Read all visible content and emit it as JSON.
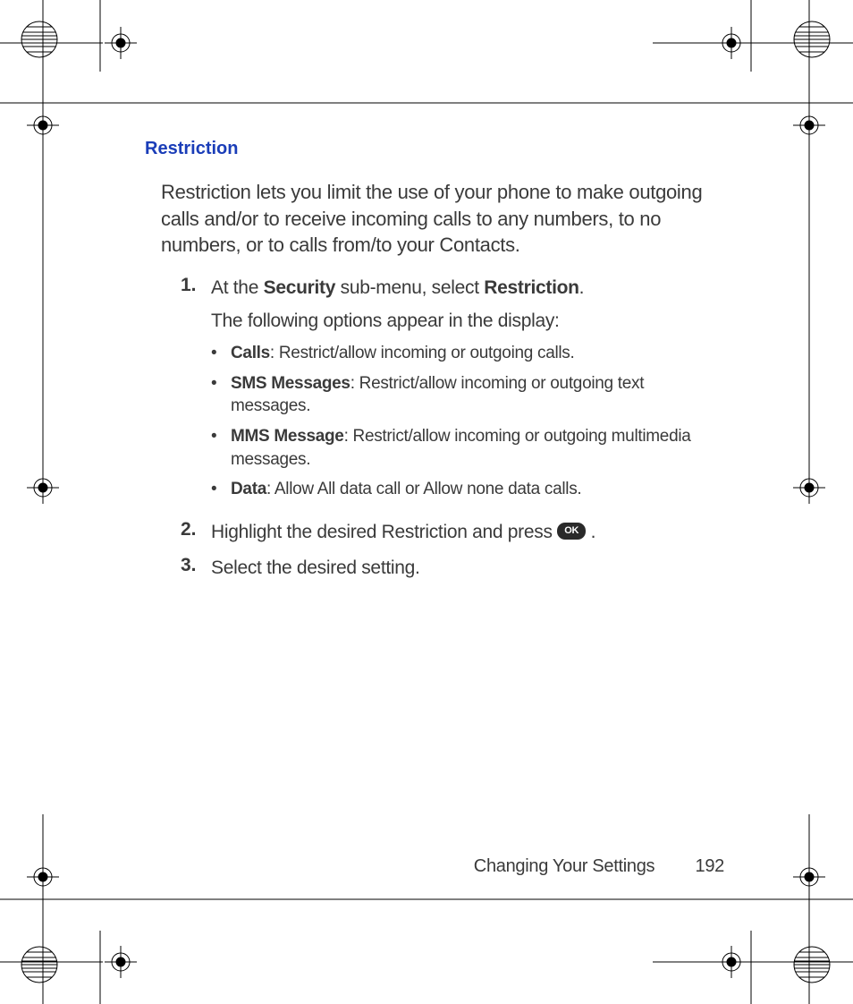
{
  "heading": "Restriction",
  "intro": "Restriction lets you limit the use of your phone to make outgoing calls and/or to receive incoming calls to any numbers, to no numbers, or to calls from/to your Contacts.",
  "steps": [
    {
      "num": "1.",
      "prefix": "At the ",
      "bold1": "Security",
      "mid": " sub-menu, select ",
      "bold2": "Restriction",
      "suffix": ".",
      "subline": "The following options appear in the display:",
      "bullets": [
        {
          "bold": "Calls",
          "rest": ": Restrict/allow incoming or outgoing calls."
        },
        {
          "bold": "SMS Messages",
          "rest": ": Restrict/allow incoming or outgoing text messages."
        },
        {
          "bold": "MMS Message",
          "rest": ": Restrict/allow incoming or outgoing multimedia messages."
        },
        {
          "bold": "Data",
          "rest": ": Allow All data call or Allow none data calls."
        }
      ]
    },
    {
      "num": "2.",
      "text_before": "Highlight the desired Restriction and press ",
      "ok_label": "OK",
      "text_after": " ."
    },
    {
      "num": "3.",
      "plain": "Select the desired setting."
    }
  ],
  "footer": {
    "section": "Changing Your Settings",
    "page": "192"
  }
}
